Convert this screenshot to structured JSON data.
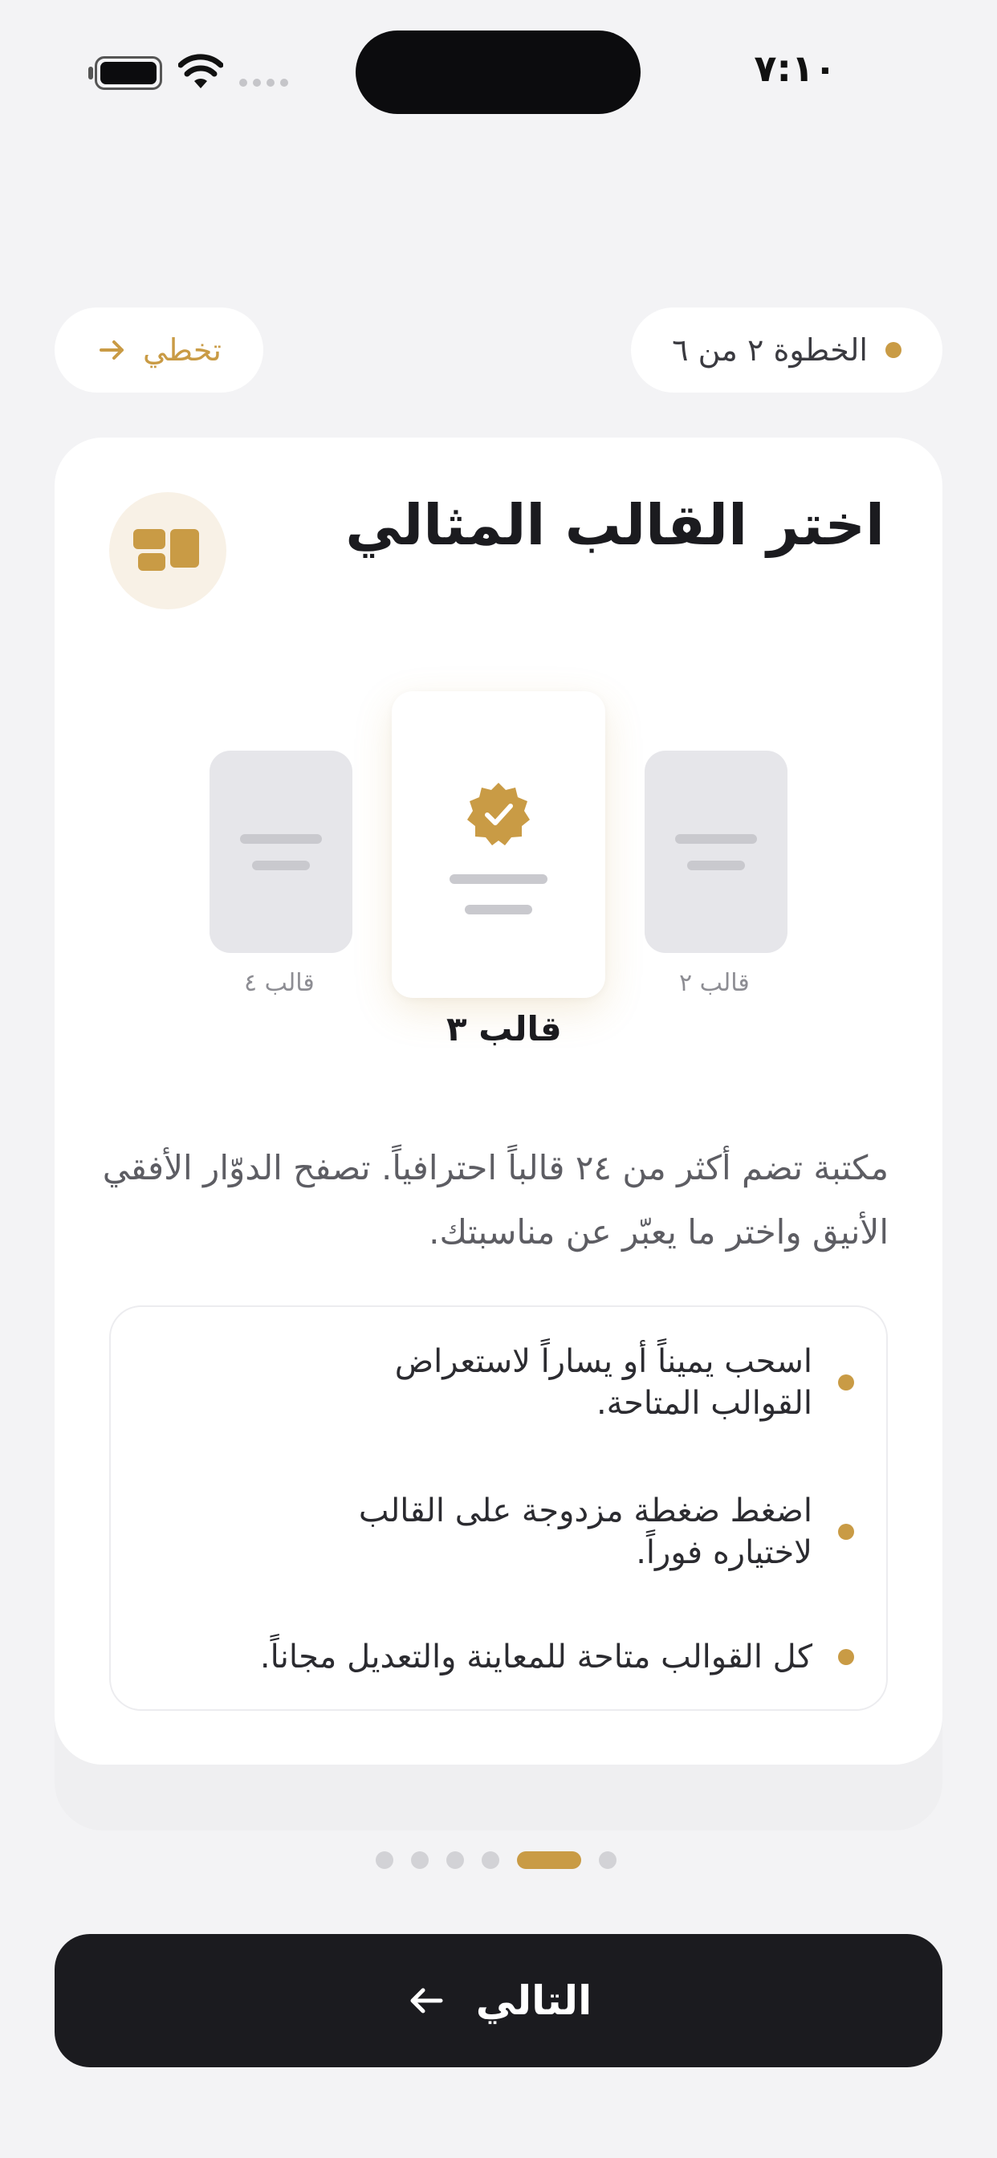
{
  "status_bar": {
    "time": "٧:١٠"
  },
  "header": {
    "step_label": "الخطوة ٢ من ٦",
    "skip_label": "تخطي"
  },
  "card": {
    "title": "اختر القالب المثالي",
    "icon": "layout-grid-icon",
    "templates": [
      {
        "label": "قالب ٢",
        "state": "side"
      },
      {
        "label": "قالب ٣",
        "state": "selected",
        "icon": "verified-badge-icon"
      },
      {
        "label": "قالب ٤",
        "state": "side"
      }
    ],
    "description": "مكتبة تضم أكثر من ٢٤ قالباً احترافياً. تصفح الدوّار الأفقي الأنيق واختر ما يعبّر عن مناسبتك.",
    "tips": [
      "اسحب يميناً أو يساراً لاستعراض القوالب المتاحة.",
      "اضغط ضغطة مزدوجة على القالب لاختياره فوراً.",
      "كل القوالب متاحة للمعاينة والتعديل مجاناً."
    ]
  },
  "pagination": {
    "total": 6,
    "current": 2
  },
  "footer": {
    "next_label": "التالي"
  },
  "colors": {
    "accent": "#c99b45",
    "dark": "#1b1b1f",
    "background": "#f3f3f5"
  }
}
